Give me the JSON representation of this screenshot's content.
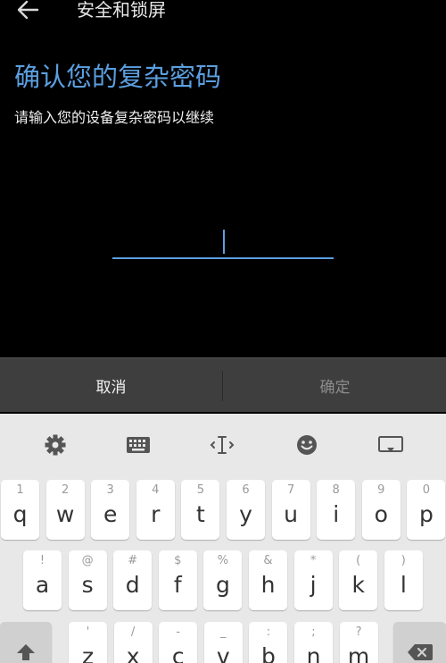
{
  "header": {
    "title": "安全和锁屏",
    "back_icon": "arrow-left-icon"
  },
  "main": {
    "title": "确认您的复杂密码",
    "subtitle": "请输入您的设备复杂密码以继续",
    "password_value": ""
  },
  "buttons": {
    "cancel": "取消",
    "confirm": "确定"
  },
  "colors": {
    "accent": "#5b9fe0",
    "background": "#000000",
    "bar": "#3e3e3e",
    "keyboard": "#e8e8e8"
  },
  "keyboard": {
    "toolbar": [
      "gear-icon",
      "keyboard-icon",
      "text-cursor-icon",
      "emoji-icon",
      "screen-icon"
    ],
    "row1": [
      {
        "hint": "1",
        "key": "q"
      },
      {
        "hint": "2",
        "key": "w"
      },
      {
        "hint": "3",
        "key": "e"
      },
      {
        "hint": "4",
        "key": "r"
      },
      {
        "hint": "5",
        "key": "t"
      },
      {
        "hint": "6",
        "key": "y"
      },
      {
        "hint": "7",
        "key": "u"
      },
      {
        "hint": "8",
        "key": "i"
      },
      {
        "hint": "9",
        "key": "o"
      },
      {
        "hint": "0",
        "key": "p"
      }
    ],
    "row2": [
      {
        "hint": "!",
        "key": "a"
      },
      {
        "hint": "@",
        "key": "s"
      },
      {
        "hint": "#",
        "key": "d"
      },
      {
        "hint": "$",
        "key": "f"
      },
      {
        "hint": "%",
        "key": "g"
      },
      {
        "hint": "&",
        "key": "h"
      },
      {
        "hint": "*",
        "key": "j"
      },
      {
        "hint": "(",
        "key": "k"
      },
      {
        "hint": ")",
        "key": "l"
      }
    ],
    "row3": [
      {
        "hint": "'",
        "key": "z"
      },
      {
        "hint": "/",
        "key": "x"
      },
      {
        "hint": "-",
        "key": "c"
      },
      {
        "hint": "_",
        "key": "v"
      },
      {
        "hint": ":",
        "key": "b"
      },
      {
        "hint": ";",
        "key": "n"
      },
      {
        "hint": "?",
        "key": "m"
      }
    ],
    "shift_icon": "shift-arrow-icon",
    "backspace_icon": "backspace-icon"
  }
}
